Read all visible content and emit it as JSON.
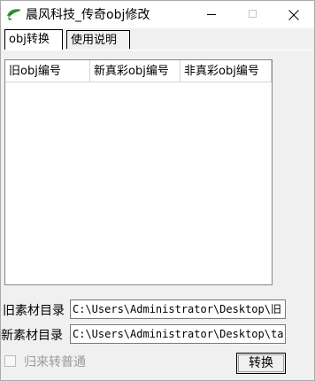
{
  "window": {
    "title": "晨风科技_传奇obj修改",
    "controls": {
      "minimize": "minimize",
      "maximize": "maximize",
      "close": "close"
    }
  },
  "tabs": [
    {
      "label": "obj转换",
      "active": true
    },
    {
      "label": "使用说明",
      "active": false
    }
  ],
  "list": {
    "columns": [
      "旧obj编号",
      "新真彩obj编号",
      "非真彩obj编号"
    ],
    "rows": []
  },
  "fields": {
    "old_dir": {
      "label": "旧素材目录",
      "value": "C:\\Users\\Administrator\\Desktop\\旧"
    },
    "new_dir": {
      "label": "新素材目录",
      "value": "C:\\Users\\Administrator\\Desktop\\ta"
    }
  },
  "options": {
    "to_normal": {
      "label": "归来转普通",
      "checked": false,
      "enabled": false
    }
  },
  "buttons": {
    "convert": "转换"
  },
  "icons": {
    "app": "app-leaf-icon"
  }
}
